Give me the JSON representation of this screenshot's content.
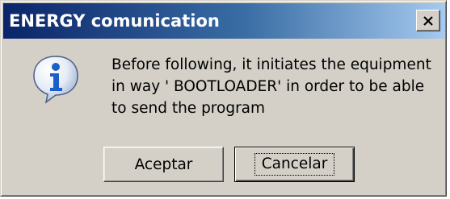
{
  "window": {
    "title": "ENERGY comunication",
    "close_icon": "close-icon"
  },
  "message": {
    "icon": "info-icon",
    "text": "Before following, it initiates the equipment\nin way ' BOOTLOADER' in order to be able\nto send the program"
  },
  "buttons": {
    "accept_label": "Aceptar",
    "cancel_label": "Cancelar"
  },
  "colors": {
    "titlebar_start": "#0a246a",
    "titlebar_end": "#a6caf0",
    "dialog_face": "#d4d0c8",
    "info_icon": "#1c5fc8"
  }
}
